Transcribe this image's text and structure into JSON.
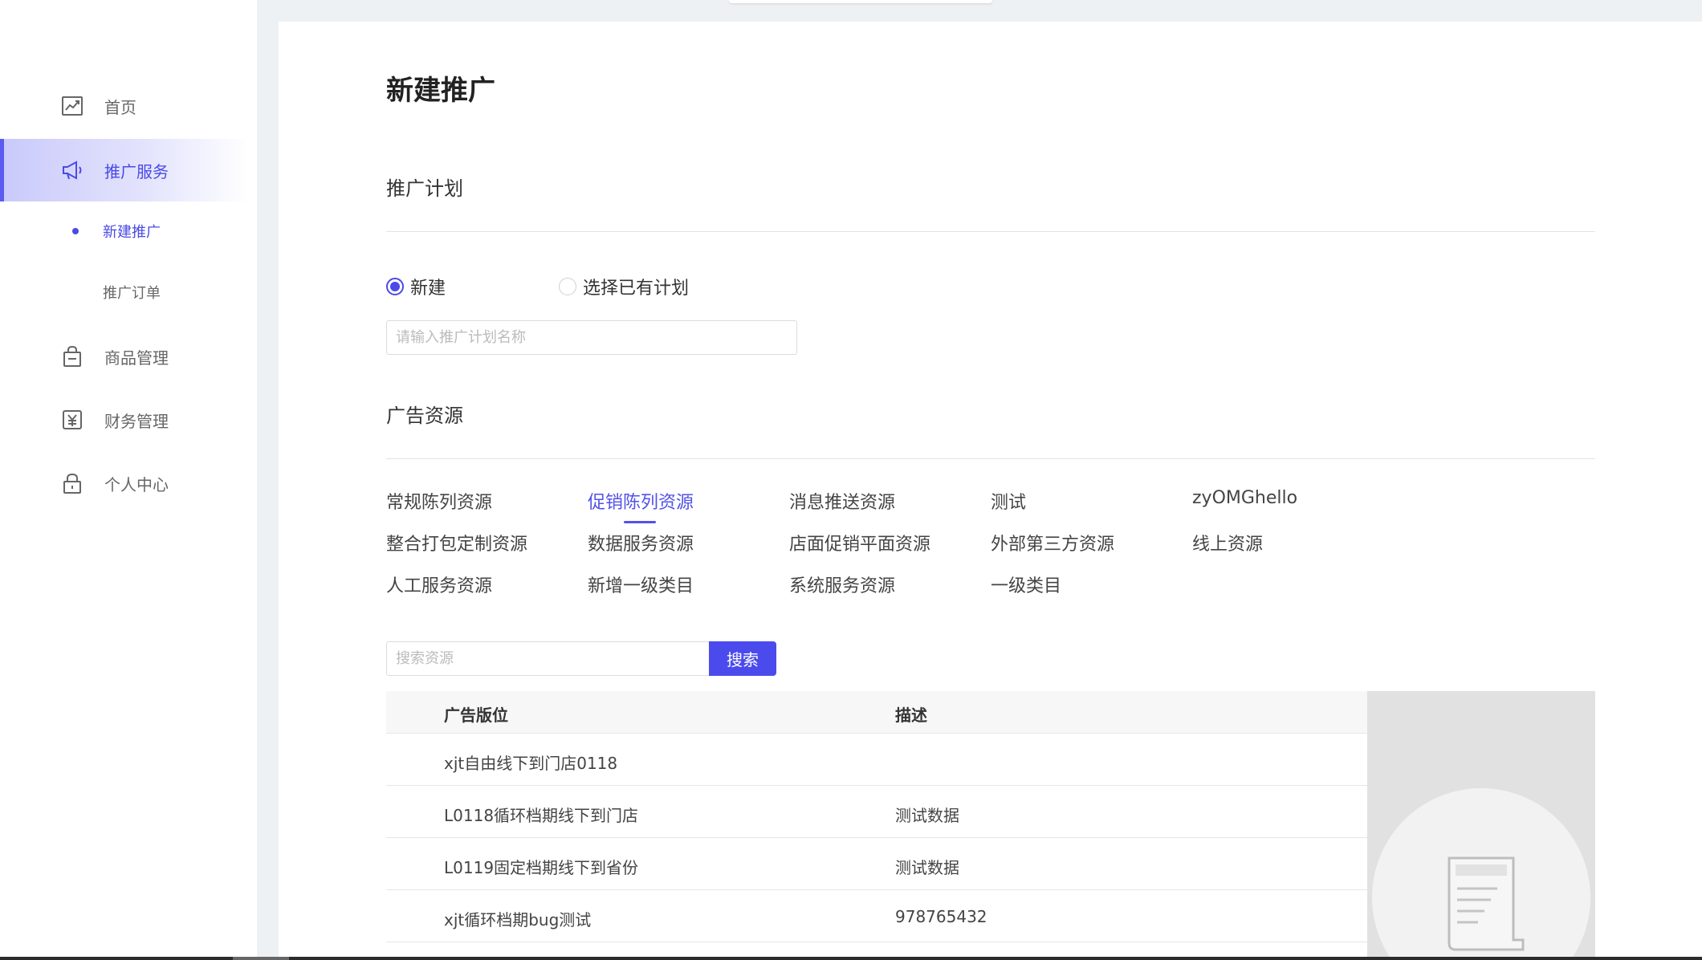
{
  "sidebar": {
    "items": [
      {
        "label": "首页",
        "icon": "chart-line-icon"
      },
      {
        "label": "推广服务",
        "icon": "megaphone-icon"
      },
      {
        "label": "商品管理",
        "icon": "bag-icon"
      },
      {
        "label": "财务管理",
        "icon": "yuan-receipt-icon"
      },
      {
        "label": "个人中心",
        "icon": "lock-icon"
      }
    ],
    "sub_items": [
      {
        "label": "新建推广"
      },
      {
        "label": "推广订单"
      }
    ]
  },
  "main": {
    "title": "新建推广",
    "plan": {
      "section_title": "推广计划",
      "radio_new": "新建",
      "radio_existing": "选择已有计划",
      "name_placeholder": "请输入推广计划名称"
    },
    "resources": {
      "section_title": "广告资源",
      "categories": [
        "常规陈列资源",
        "促销陈列资源",
        "消息推送资源",
        "测试",
        "zyOMGhello",
        "整合打包定制资源",
        "数据服务资源",
        "店面促销平面资源",
        "外部第三方资源",
        "线上资源",
        "人工服务资源",
        "新增一级类目",
        "系统服务资源",
        "一级类目"
      ],
      "active_category": "促销陈列资源",
      "search_placeholder": "搜索资源",
      "search_button": "搜索"
    },
    "table": {
      "columns": [
        "广告版位",
        "描述"
      ],
      "rows": [
        {
          "position": "xjt自由线下到门店0118",
          "desc": ""
        },
        {
          "position": "L0118循环档期线下到门店",
          "desc": "测试数据"
        },
        {
          "position": "L0119固定档期线下到省份",
          "desc": "测试数据"
        },
        {
          "position": "xjt循环档期bug测试",
          "desc": "978765432"
        }
      ]
    }
  },
  "colors": {
    "accent": "#4b4bed",
    "active_text": "#4a4ae6",
    "background": "#eef1f4"
  }
}
